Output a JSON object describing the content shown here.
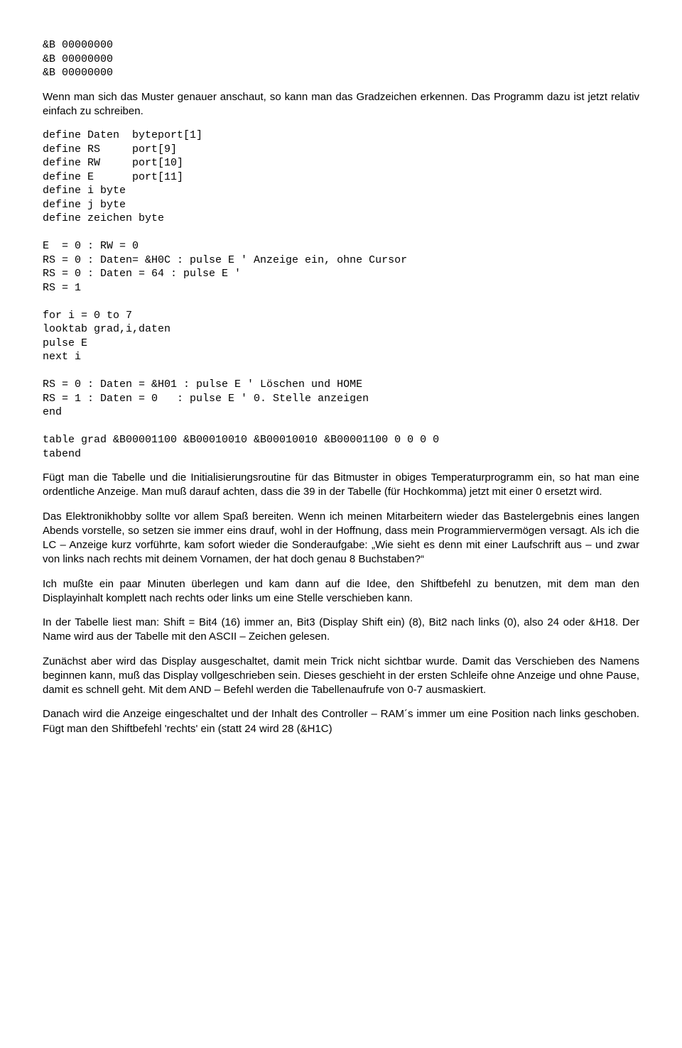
{
  "code1": "&B 00000000\n&B 00000000\n&B 00000000",
  "para1": "Wenn man sich das Muster genauer anschaut, so kann man das Gradzeichen erkennen. Das Programm dazu ist jetzt relativ einfach zu schreiben.",
  "code2": "define Daten  byteport[1]\ndefine RS     port[9]\ndefine RW     port[10]\ndefine E      port[11]\ndefine i byte\ndefine j byte\ndefine zeichen byte\n\nE  = 0 : RW = 0\nRS = 0 : Daten= &H0C : pulse E ' Anzeige ein, ohne Cursor\nRS = 0 : Daten = 64 : pulse E '\nRS = 1\n\nfor i = 0 to 7\nlooktab grad,i,daten\npulse E\nnext i\n\nRS = 0 : Daten = &H01 : pulse E ' Löschen und HOME\nRS = 1 : Daten = 0   : pulse E ' 0. Stelle anzeigen\nend\n\ntable grad &B00001100 &B00010010 &B00010010 &B00001100 0 0 0 0\ntabend",
  "para2": "Fügt man die Tabelle und die Initialisierungsroutine für das Bitmuster in obiges Temperaturprogramm ein, so hat man eine ordentliche Anzeige. Man muß darauf achten, dass die 39 in der Tabelle (für Hochkomma) jetzt mit einer 0 ersetzt wird.",
  "para3": "Das Elektronikhobby sollte vor allem Spaß bereiten. Wenn ich meinen Mitarbeitern wieder das Bastelergebnis eines langen Abends vorstelle, so setzen sie immer eins drauf, wohl in der Hoffnung, dass mein Programmiervermögen versagt. Als ich die LC – Anzeige kurz vorführte, kam sofort wieder die Sonderaufgabe: „Wie sieht es denn mit einer Laufschrift aus – und zwar von links nach rechts mit deinem Vornamen, der hat doch genau 8 Buchstaben?“",
  "para4": "Ich mußte ein paar Minuten überlegen und kam dann auf die Idee, den Shiftbefehl zu benutzen, mit dem man den Displayinhalt komplett nach rechts oder links um eine Stelle verschieben kann.",
  "para5": "In der Tabelle liest man: Shift = Bit4 (16) immer an, Bit3 (Display Shift ein) (8), Bit2 nach links (0), also 24 oder &H18. Der Name wird aus der Tabelle mit den ASCII – Zeichen gelesen.",
  "para6": "Zunächst aber wird das Display ausgeschaltet, damit mein Trick nicht sichtbar wurde. Damit das Verschieben des Namens beginnen kann, muß das Display vollgeschrieben sein. Dieses geschieht in der ersten Schleife ohne Anzeige und ohne Pause, damit es schnell geht. Mit dem AND – Befehl werden die Tabellenaufrufe von 0-7 ausmaskiert.",
  "para7": "Danach wird die Anzeige eingeschaltet und der Inhalt des Controller – RAM´s immer um eine Position nach links geschoben. Fügt man den Shiftbefehl 'rechts' ein (statt 24 wird 28 (&H1C)"
}
